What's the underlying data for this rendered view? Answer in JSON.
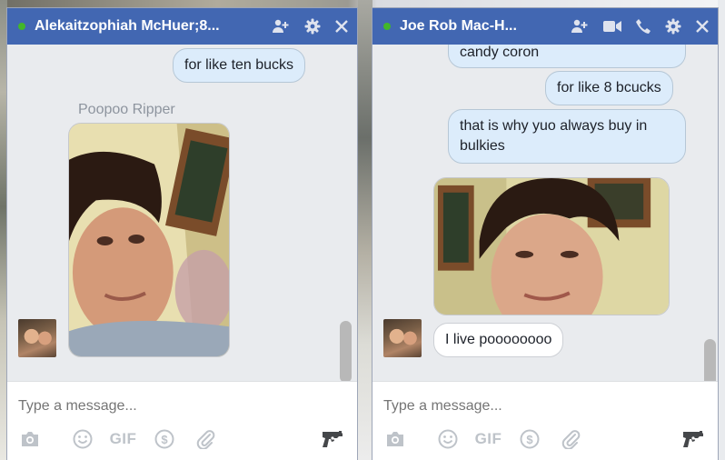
{
  "chat1": {
    "title": "Alekaitzophiah McHuer;8...",
    "messages": {
      "out1": "for like ten bucks"
    },
    "sender_name": "Poopoo Ripper",
    "input_placeholder": "Type a message...",
    "gif_label": "GIF"
  },
  "chat2": {
    "title": "Joe Rob Mac-H...",
    "messages": {
      "out1": "candy coron",
      "out2": "for like 8 bcucks",
      "out3": "that is why yuo always buy in bulkies",
      "in1": "I live poooooooo"
    },
    "input_placeholder": "Type a message...",
    "gif_label": "GIF"
  },
  "colors": {
    "titlebar": "#4267b2",
    "online": "#42b72a",
    "outgoing_bubble": "#dcecfb",
    "incoming_bubble": "#ffffff",
    "panel": "#e9ebee"
  },
  "icons": [
    "online-dot",
    "add-people-icon",
    "video-icon",
    "phone-icon",
    "gear-icon",
    "close-icon",
    "camera-icon",
    "emoji-icon",
    "gif-icon",
    "money-icon",
    "paperclip-icon",
    "gun-icon"
  ]
}
